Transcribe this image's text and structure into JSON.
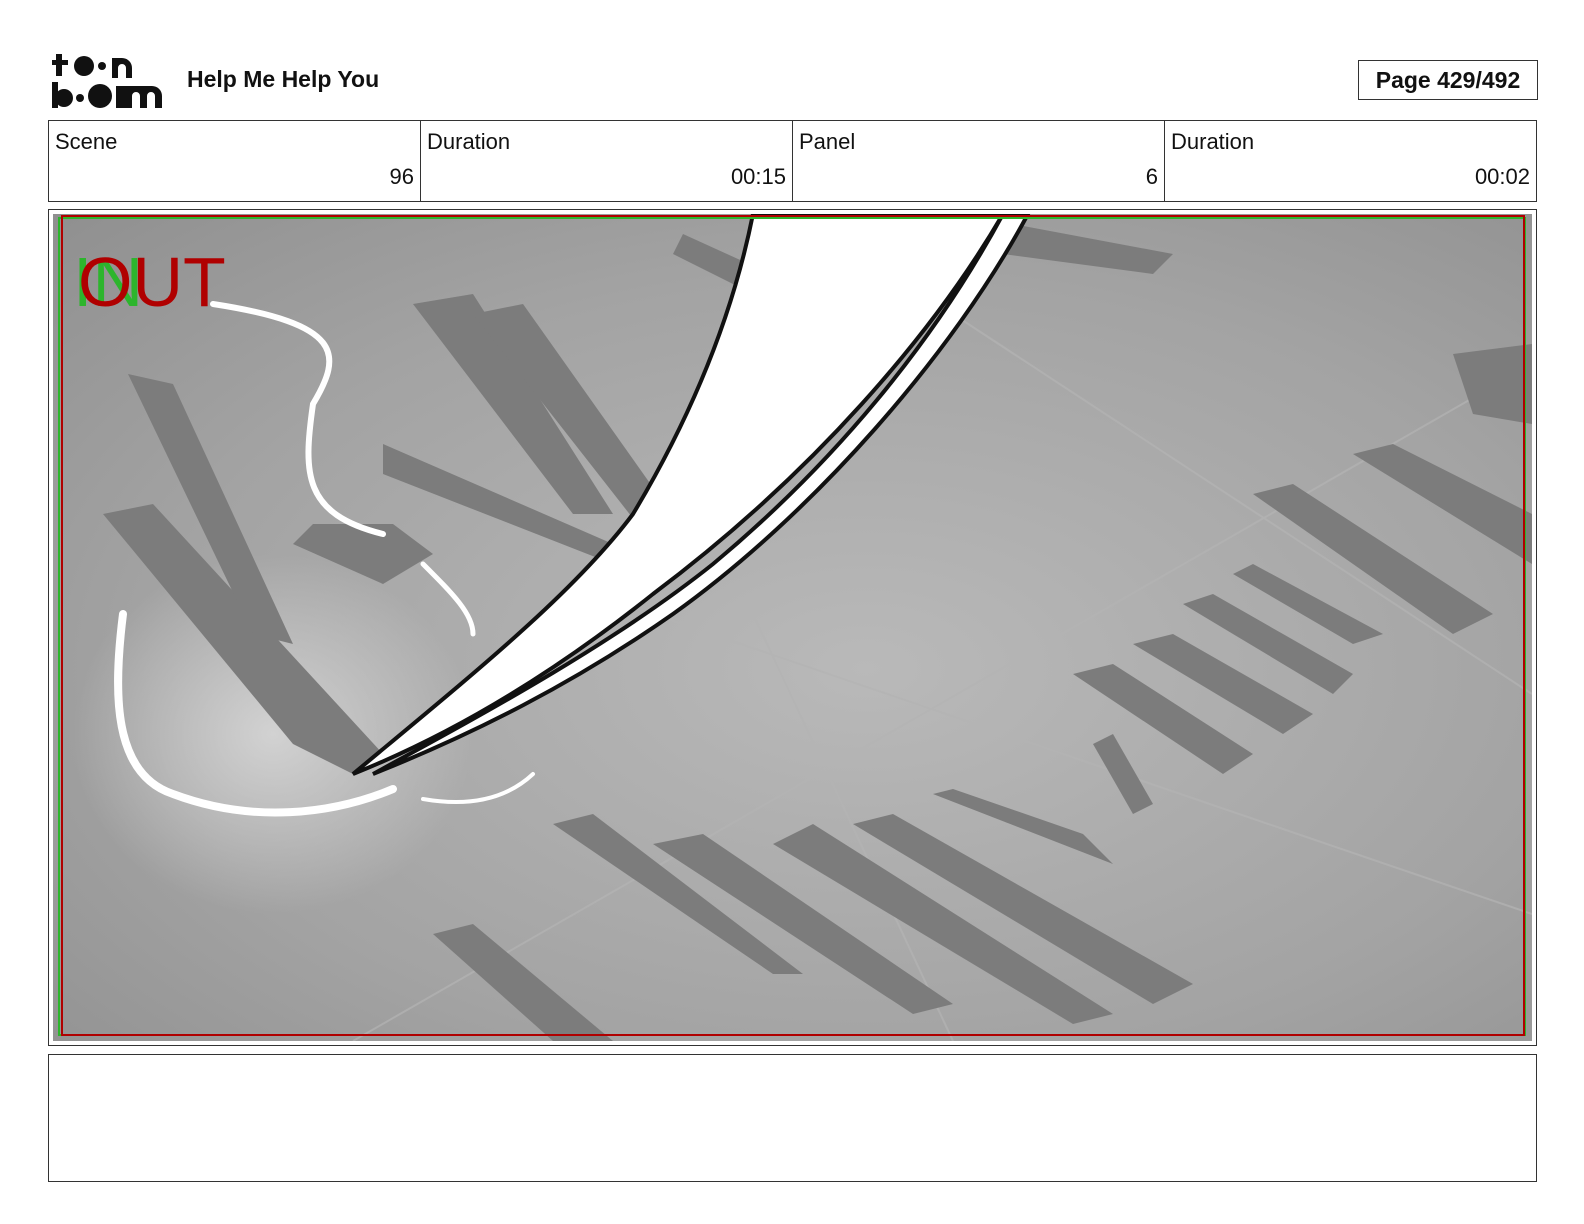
{
  "header": {
    "logo_text": "toon boom",
    "project_title": "Help Me Help You",
    "page_counter": "Page 429/492"
  },
  "info": {
    "scene_label": "Scene",
    "scene_value": "96",
    "scene_duration_label": "Duration",
    "scene_duration_value": "00:15",
    "panel_label": "Panel",
    "panel_value": "6",
    "panel_duration_label": "Duration",
    "panel_duration_value": "00:02"
  },
  "panel": {
    "in_marker": "IN",
    "out_marker": "OUT",
    "in_color": "#2db52d",
    "out_color": "#b00000"
  },
  "notes": {
    "text": ""
  }
}
